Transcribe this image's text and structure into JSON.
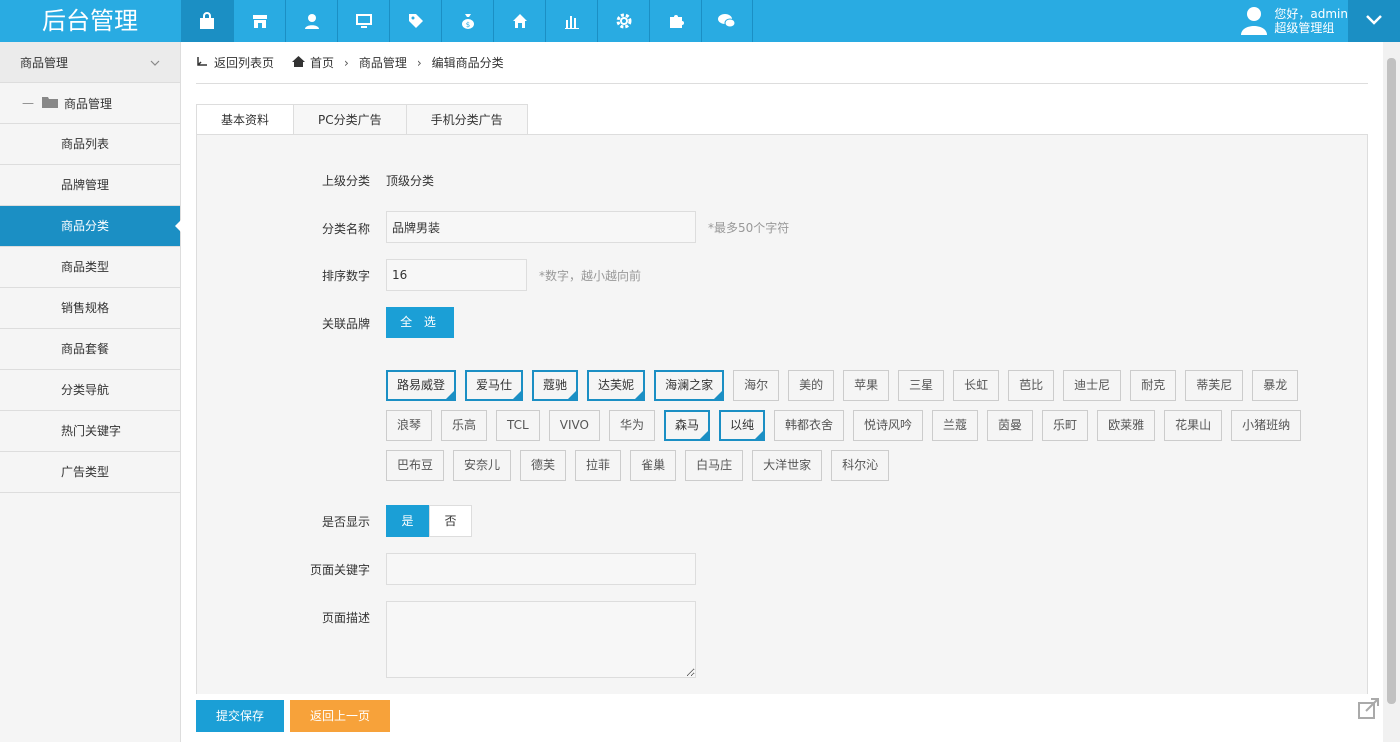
{
  "app": {
    "title": "后台管理"
  },
  "user": {
    "greeting": "您好，admin",
    "role": "超级管理组"
  },
  "nav_icons": [
    "bag-icon",
    "shop-icon",
    "user-icon",
    "monitor-icon",
    "tag-icon",
    "money-bag-icon",
    "home-icon",
    "bar-chart-icon",
    "gear-icon",
    "puzzle-icon",
    "wechat-icon"
  ],
  "sidebar": {
    "header": "商品管理",
    "folder": "商品管理",
    "items": [
      {
        "label": "商品列表"
      },
      {
        "label": "品牌管理"
      },
      {
        "label": "商品分类",
        "active": true
      },
      {
        "label": "商品类型"
      },
      {
        "label": "销售规格"
      },
      {
        "label": "商品套餐"
      },
      {
        "label": "分类导航"
      },
      {
        "label": "热门关键字"
      },
      {
        "label": "广告类型"
      }
    ]
  },
  "breadcrumb": {
    "back": "返回列表页",
    "home": "首页",
    "section": "商品管理",
    "current": "编辑商品分类"
  },
  "tabs": [
    "基本资料",
    "PC分类广告",
    "手机分类广告"
  ],
  "form": {
    "parent_label": "上级分类",
    "parent_value": "顶级分类",
    "name_label": "分类名称",
    "name_value": "品牌男装",
    "name_hint": "*最多50个字符",
    "sort_label": "排序数字",
    "sort_value": "16",
    "sort_hint": "*数字，越小越向前",
    "brand_label": "关联品牌",
    "select_all": "全 选",
    "brands": [
      [
        {
          "name": "路易威登",
          "sel": true
        },
        {
          "name": "爱马仕",
          "sel": true
        },
        {
          "name": "蔻驰",
          "sel": true
        },
        {
          "name": "达芙妮",
          "sel": true
        },
        {
          "name": "海澜之家",
          "sel": true
        },
        {
          "name": "海尔"
        },
        {
          "name": "美的"
        },
        {
          "name": "苹果"
        },
        {
          "name": "三星"
        },
        {
          "name": "长虹"
        },
        {
          "name": "芭比"
        },
        {
          "name": "迪士尼"
        },
        {
          "name": "耐克"
        },
        {
          "name": "蒂芙尼"
        },
        {
          "name": "暴龙"
        }
      ],
      [
        {
          "name": "浪琴"
        },
        {
          "name": "乐高"
        },
        {
          "name": "TCL"
        },
        {
          "name": "VIVO"
        },
        {
          "name": "华为"
        },
        {
          "name": "森马",
          "sel": true
        },
        {
          "name": "以纯",
          "sel": true
        },
        {
          "name": "韩都衣舍"
        },
        {
          "name": "悦诗风吟"
        },
        {
          "name": "兰蔻"
        },
        {
          "name": "茵曼"
        },
        {
          "name": "乐町"
        },
        {
          "name": "欧莱雅"
        },
        {
          "name": "花果山"
        },
        {
          "name": "小猪班纳"
        }
      ],
      [
        {
          "name": "巴布豆"
        },
        {
          "name": "安奈儿"
        },
        {
          "name": "德芙"
        },
        {
          "name": "拉菲"
        },
        {
          "name": "雀巢"
        },
        {
          "name": "白马庄"
        },
        {
          "name": "大洋世家"
        },
        {
          "name": "科尔沁"
        }
      ]
    ],
    "display_label": "是否显示",
    "display_yes": "是",
    "display_no": "否",
    "keywords_label": "页面关键字",
    "keywords_value": "",
    "desc_label": "页面描述",
    "desc_value": ""
  },
  "actions": {
    "save": "提交保存",
    "back": "返回上一页"
  },
  "colors": {
    "primary": "#29abe2",
    "dark": "#1b8fc4",
    "orange": "#f7a23a"
  }
}
